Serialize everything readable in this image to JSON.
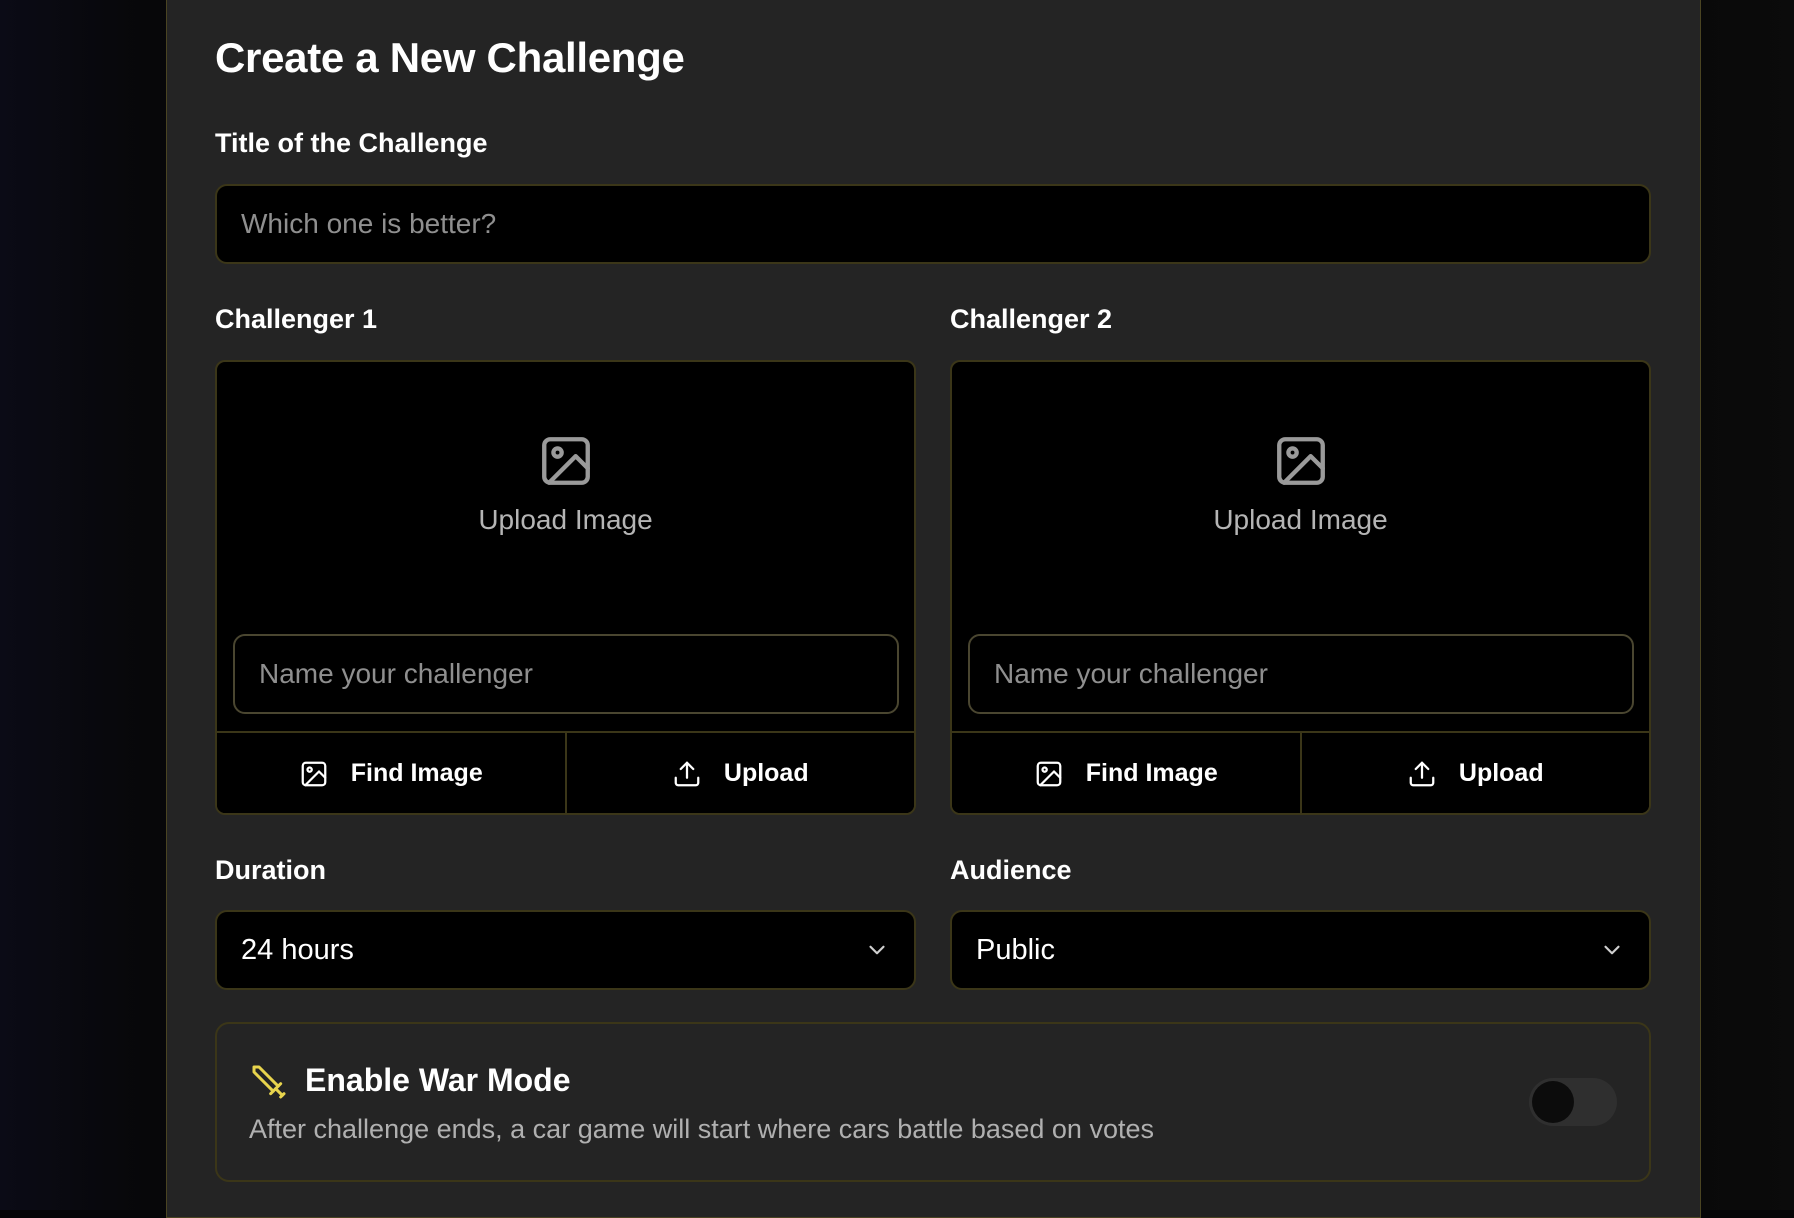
{
  "form": {
    "title": "Create a New Challenge",
    "challenge_title": {
      "label": "Title of the Challenge",
      "placeholder": "Which one is better?",
      "value": ""
    },
    "challengers": [
      {
        "label": "Challenger 1",
        "upload_label": "Upload Image",
        "name_placeholder": "Name your challenger",
        "find_image_label": "Find Image",
        "upload_button_label": "Upload"
      },
      {
        "label": "Challenger 2",
        "upload_label": "Upload Image",
        "name_placeholder": "Name your challenger",
        "find_image_label": "Find Image",
        "upload_button_label": "Upload"
      }
    ],
    "duration": {
      "label": "Duration",
      "value": "24 hours"
    },
    "audience": {
      "label": "Audience",
      "value": "Public"
    },
    "war_mode": {
      "title": "Enable War Mode",
      "description": "After challenge ends, a car game will start where cars battle based on votes",
      "enabled": false,
      "icon": "sword-icon"
    }
  },
  "colors": {
    "panel": "#242424",
    "accent_border": "#3b3618",
    "war_icon": "#e8d44d",
    "placeholder": "#8f8f8f"
  }
}
